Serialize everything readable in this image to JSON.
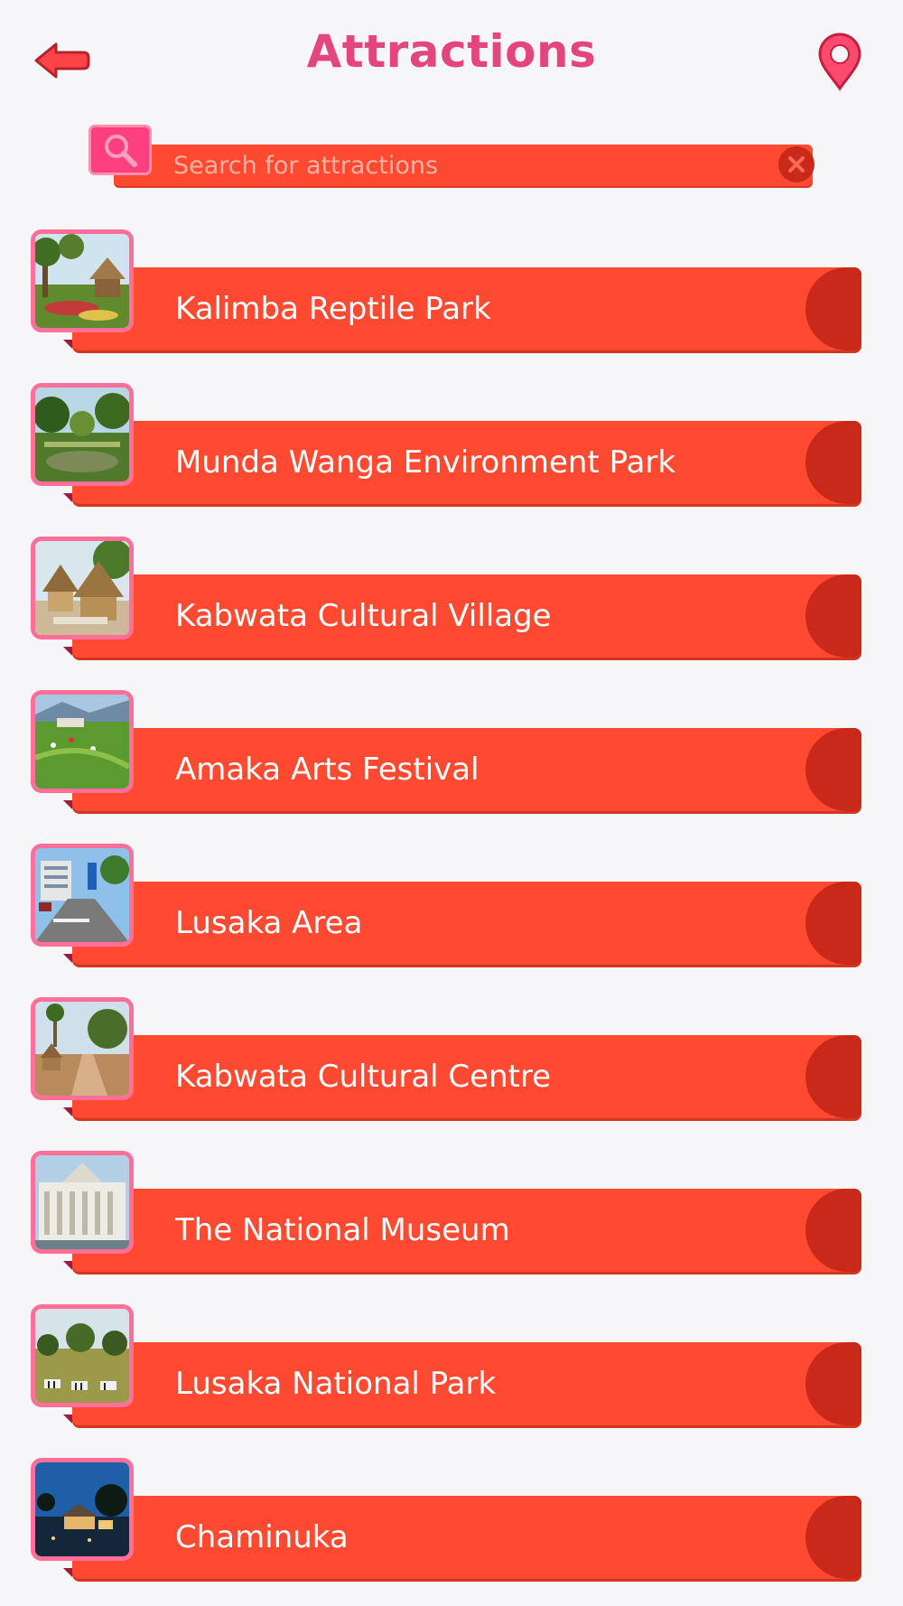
{
  "header": {
    "title": "Attractions",
    "back_icon": "back-arrow-icon",
    "map_icon": "map-pin-icon"
  },
  "search": {
    "placeholder": "Search for attractions",
    "value": "",
    "search_icon": "search-icon",
    "clear_icon": "close-icon"
  },
  "colors": {
    "title": "#e5457d",
    "bar": "#ff4930",
    "bar_tail": "#c9291a",
    "thumb_border": "#ff6f9a",
    "background": "#f6f6f8"
  },
  "attractions": [
    {
      "label": "Kalimba Reptile Park",
      "photo": "park with trees and thatched huts"
    },
    {
      "label": "Munda Wanga Environment Park",
      "photo": "garden with trees and pond"
    },
    {
      "label": "Kabwata Cultural Village",
      "photo": "thatched huts"
    },
    {
      "label": "Amaka Arts Festival",
      "photo": "green lawn with crowd"
    },
    {
      "label": "Lusaka Area",
      "photo": "city street"
    },
    {
      "label": "Kabwata Cultural Centre",
      "photo": "village path with trees"
    },
    {
      "label": "The National Museum",
      "photo": "museum building"
    },
    {
      "label": "Lusaka National Park",
      "photo": "zebras in savanna"
    },
    {
      "label": "Chaminuka",
      "photo": "lodge at dusk"
    }
  ]
}
